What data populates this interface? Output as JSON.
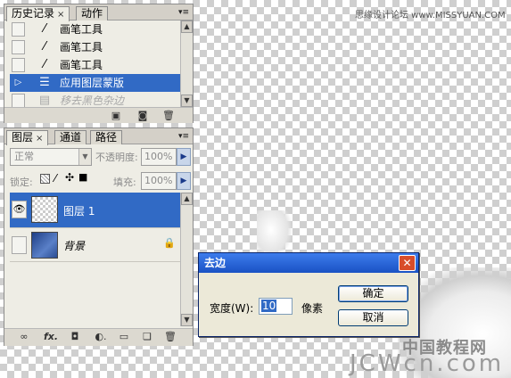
{
  "watermark_top": "思缘设计论坛 www.MISSYUAN.COM",
  "watermark_bottom_cn": "中国教程网",
  "watermark_bottom_en": "JCWcn.com",
  "history_panel": {
    "tabs": [
      "历史记录",
      "动作"
    ],
    "close_glyph": "×",
    "menu_glyph": "▾≡",
    "items": [
      {
        "label": "画笔工具",
        "icon": "brush-icon",
        "state": "normal"
      },
      {
        "label": "画笔工具",
        "icon": "brush-icon",
        "state": "normal"
      },
      {
        "label": "画笔工具",
        "icon": "brush-icon",
        "state": "normal"
      },
      {
        "label": "应用图层蒙版",
        "icon": "layer-mask-icon",
        "state": "selected"
      },
      {
        "label": "移去黑色杂边",
        "icon": "document-icon",
        "state": "disabled"
      }
    ]
  },
  "layers_panel": {
    "tabs": [
      "图层",
      "通道",
      "路径"
    ],
    "blend_mode": "正常",
    "opacity_label": "不透明度:",
    "opacity_value": "100%",
    "lock_label": "锁定:",
    "fill_label": "填充:",
    "fill_value": "100%",
    "layers": [
      {
        "name": "图层 1",
        "visible": true,
        "selected": true
      },
      {
        "name": "背景",
        "visible": false,
        "selected": false,
        "locked": true
      }
    ],
    "bottom_icons": [
      "link-icon",
      "fx-icon",
      "mask-icon",
      "adjustment-icon",
      "folder-icon",
      "new-layer-icon",
      "trash-icon"
    ]
  },
  "dialog": {
    "title": "去边",
    "width_label": "宽度(W):",
    "width_value": "10",
    "unit": "像素",
    "ok": "确定",
    "cancel": "取消"
  },
  "colors": {
    "selection": "#316ac5",
    "dialog_title": "#1a52c4"
  }
}
